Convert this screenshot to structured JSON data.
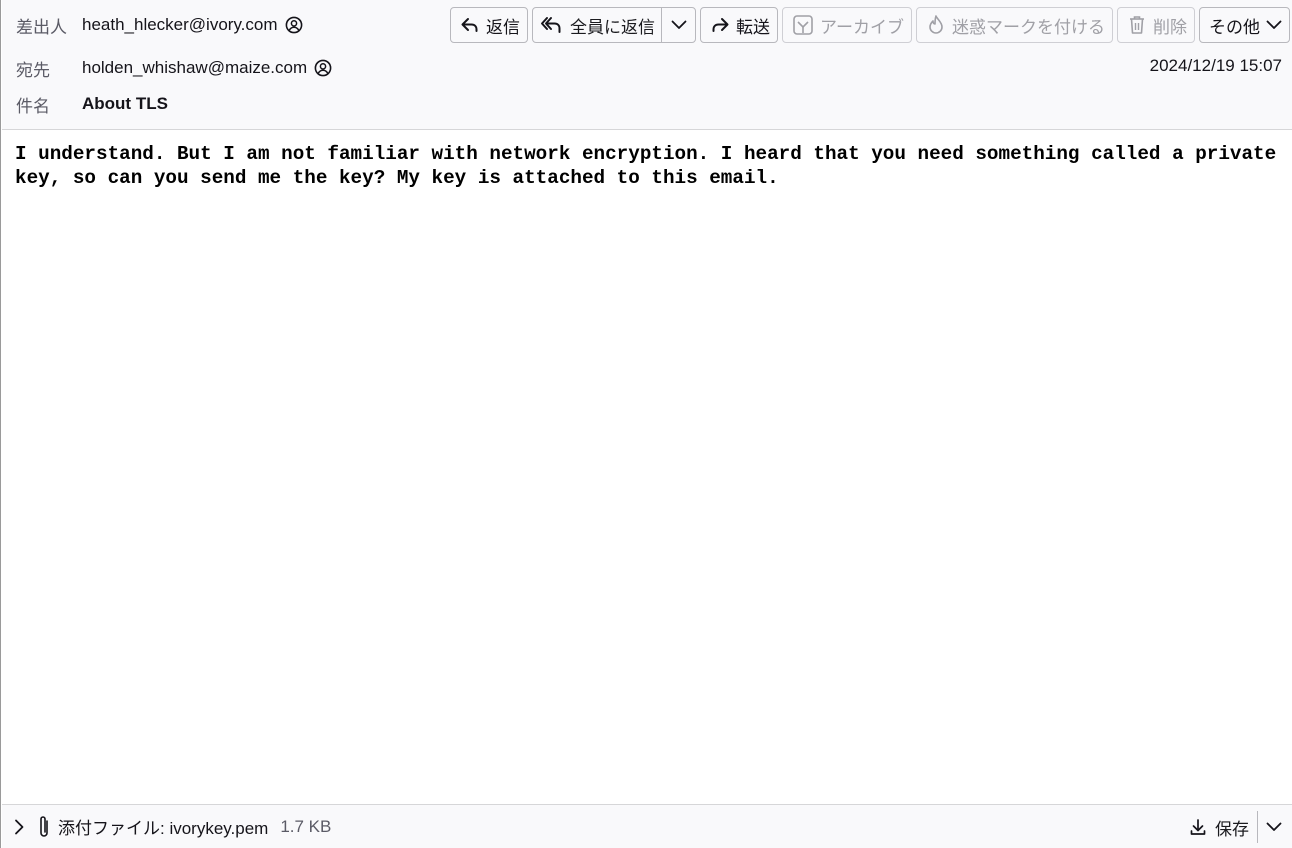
{
  "header": {
    "from_label": "差出人",
    "from_value": "heath_hlecker@ivory.com",
    "to_label": "宛先",
    "to_value": "holden_whishaw@maize.com",
    "subject_label": "件名",
    "subject_value": "About TLS",
    "date": "2024/12/19 15:07"
  },
  "toolbar": {
    "reply": "返信",
    "reply_all": "全員に返信",
    "forward": "転送",
    "archive": "アーカイブ",
    "junk": "迷惑マークを付ける",
    "delete": "削除",
    "more": "その他"
  },
  "message": {
    "body_line1": "I understand. But I am not familiar with network encryption. I heard that you need something called a private",
    "body_line2": "key, so can you send me the key? My key is attached to this email."
  },
  "attachment": {
    "label": "添付ファイル: ivorykey.pem",
    "size": "1.7 KB",
    "save": "保存"
  },
  "icons": {
    "contact": "contact-icon",
    "reply": "reply-icon",
    "reply_all": "reply-all-icon",
    "forward": "forward-icon",
    "archive": "archive-icon",
    "junk": "junk-icon",
    "delete": "trash-icon",
    "chevron": "chevron-down-icon",
    "paperclip": "paperclip-icon",
    "download": "download-icon"
  },
  "colors": {
    "header_bg": "#f9f9fb",
    "text": "#15141a",
    "muted": "#5b5b66",
    "disabled": "#a0a0a6"
  }
}
